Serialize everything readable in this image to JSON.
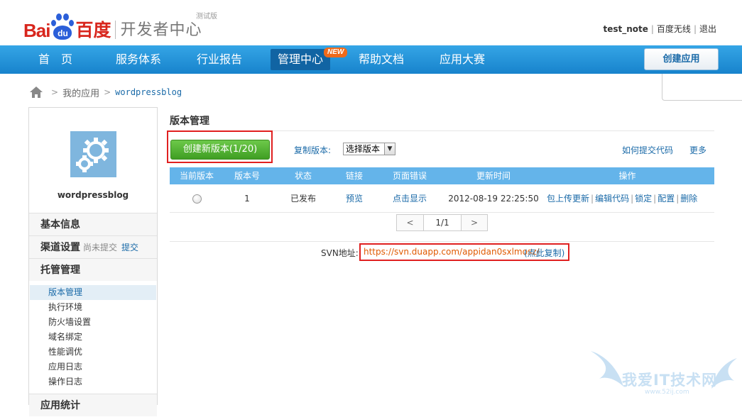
{
  "header": {
    "logo_bai": "Bai",
    "logo_du": "du",
    "logo_cn": "百度",
    "title": "开发者中心",
    "badge": "测试版",
    "user": "test_note",
    "wireless": "百度无线",
    "logout": "退出",
    "separator": "|"
  },
  "nav": {
    "items": [
      "首　页",
      "服务体系",
      "行业报告",
      "管理中心",
      "帮助文档",
      "应用大赛"
    ],
    "new_badge": "NEW",
    "create_app": "创建应用"
  },
  "breadcrumb": {
    "my_apps": "我的应用",
    "current": "wordpressblog",
    "separator": ">"
  },
  "sidebar": {
    "app_name": "wordpressblog",
    "sections": {
      "basic": "基本信息",
      "channel": "渠道设置",
      "channel_note": "尚未提交",
      "channel_submit": "提交",
      "hosting": "托管管理"
    },
    "items": [
      "版本管理",
      "执行环境",
      "防火墙设置",
      "域名绑定",
      "性能调优",
      "应用日志",
      "操作日志"
    ],
    "next_section": "应用统计"
  },
  "main": {
    "title": "版本管理",
    "create_version": "创建新版本(1/20)",
    "copy_label": "复制版本:",
    "select_value": "选择版本",
    "how_submit": "如何提交代码",
    "more": "更多",
    "columns": [
      "当前版本",
      "版本号",
      "状态",
      "链接",
      "页面错误",
      "更新时间",
      "操作"
    ],
    "row": {
      "version": "1",
      "status": "已发布",
      "link": "预览",
      "error": "点击显示",
      "updated": "2012-08-19 22:25:50",
      "ops": [
        "包上传更新",
        "编辑代码",
        "锁定",
        "配置",
        "删除"
      ]
    },
    "pager": {
      "prev": "<",
      "page": "1/1",
      "next": ">"
    },
    "svn_label": "SVN地址:",
    "svn_url": "https://svn.duapp.com/appidan0sxlmosz/",
    "svn_copy": "(点此复制)"
  },
  "watermark": {
    "text": "我爱IT技术网",
    "url": "www.52ij.com"
  },
  "colors": {
    "nav": "#1d8fd6",
    "brand_red": "#d8261d",
    "brand_blue": "#2b5fd9",
    "green_button": "#4caf2b",
    "highlight_box": "#e02020"
  }
}
